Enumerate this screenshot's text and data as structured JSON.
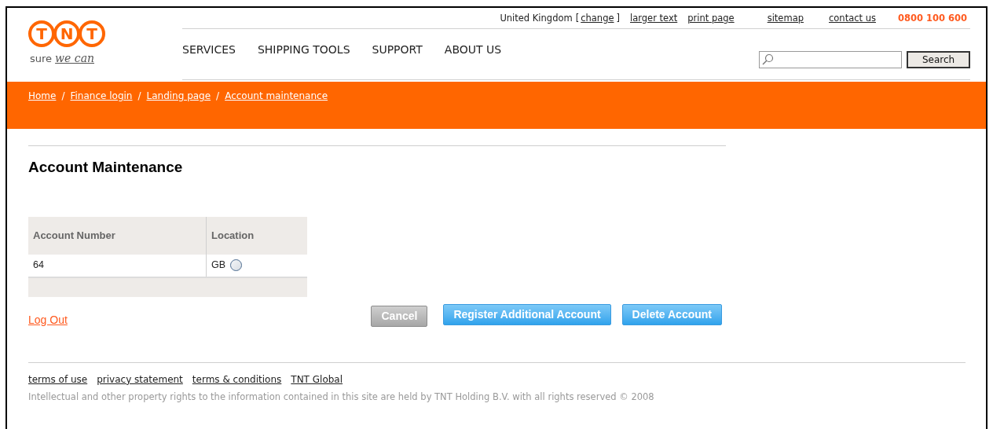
{
  "logo": {
    "letters": [
      "T",
      "N",
      "T"
    ],
    "tagline_plain": "sure",
    "tagline_script": "we can"
  },
  "utility_bar": {
    "country": "United Kingdom",
    "bracket_open": "[",
    "change": "change",
    "bracket_close": "]",
    "links": [
      "larger text",
      "print page",
      "sitemap",
      "contact us"
    ],
    "phone": "0800 100 600"
  },
  "nav": [
    "SERVICES",
    "SHIPPING TOOLS",
    "SUPPORT",
    "ABOUT US"
  ],
  "search": {
    "button": "Search"
  },
  "breadcrumb": [
    "Home",
    "Finance login",
    "Landing page",
    "Account maintenance"
  ],
  "breadcrumb_separator": "/",
  "page_title": "Account Maintenance",
  "table": {
    "columns": [
      "Account Number",
      "Location"
    ],
    "rows": [
      {
        "account_number": "64",
        "location": "GB",
        "selected": false
      }
    ]
  },
  "log_out": "Log Out",
  "buttons": [
    {
      "label": "Cancel",
      "disabled": true
    },
    {
      "label": "Register Additional Account",
      "disabled": false
    },
    {
      "label": "Delete Account",
      "disabled": false
    }
  ],
  "footer": {
    "links": [
      "terms of use",
      "privacy statement",
      "terms & conditions",
      "TNT Global"
    ],
    "copyright": "Intellectual and other property rights to the information contained in this site are held by TNT Holding B.V. with all rights reserved © 2008"
  }
}
